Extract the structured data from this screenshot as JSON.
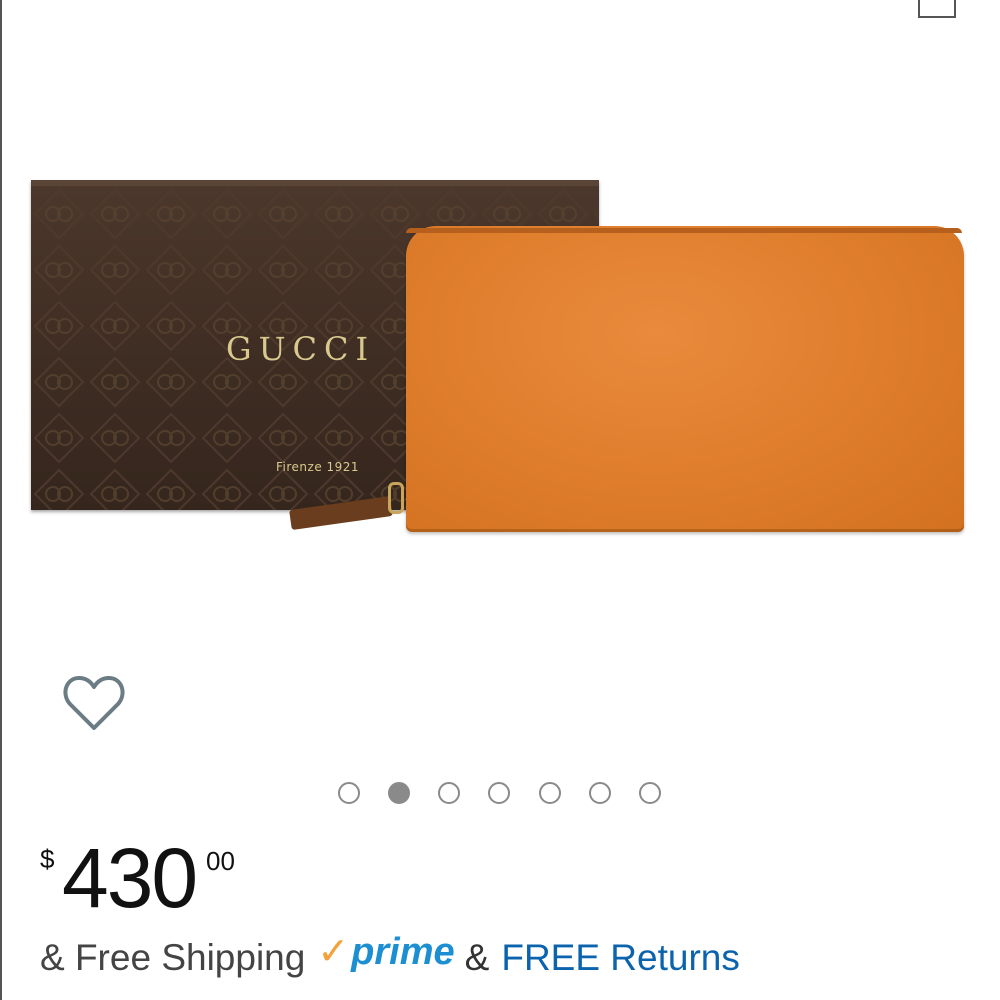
{
  "product": {
    "brand_text": "GUCCI",
    "brand_subtext": "Firenze 1921",
    "image_icon": "wallet-product-image"
  },
  "wishlist": {
    "icon": "heart-outline-icon"
  },
  "carousel": {
    "dot_count": 7,
    "active_index": 1
  },
  "price": {
    "currency": "$",
    "whole": "430",
    "fraction": "00"
  },
  "shipping": {
    "prefix": "& Free Shipping",
    "prime_check": "✓",
    "prime_word": "prime",
    "ampersand": "&",
    "returns_label": "FREE Returns"
  },
  "colors": {
    "link": "#0b63ad",
    "prime_blue": "#1c8fd3",
    "prime_orange": "#f3a23a",
    "wallet_orange": "#e07f2e",
    "box_brown": "#3d2c22",
    "brand_gold": "#d9c98f"
  }
}
